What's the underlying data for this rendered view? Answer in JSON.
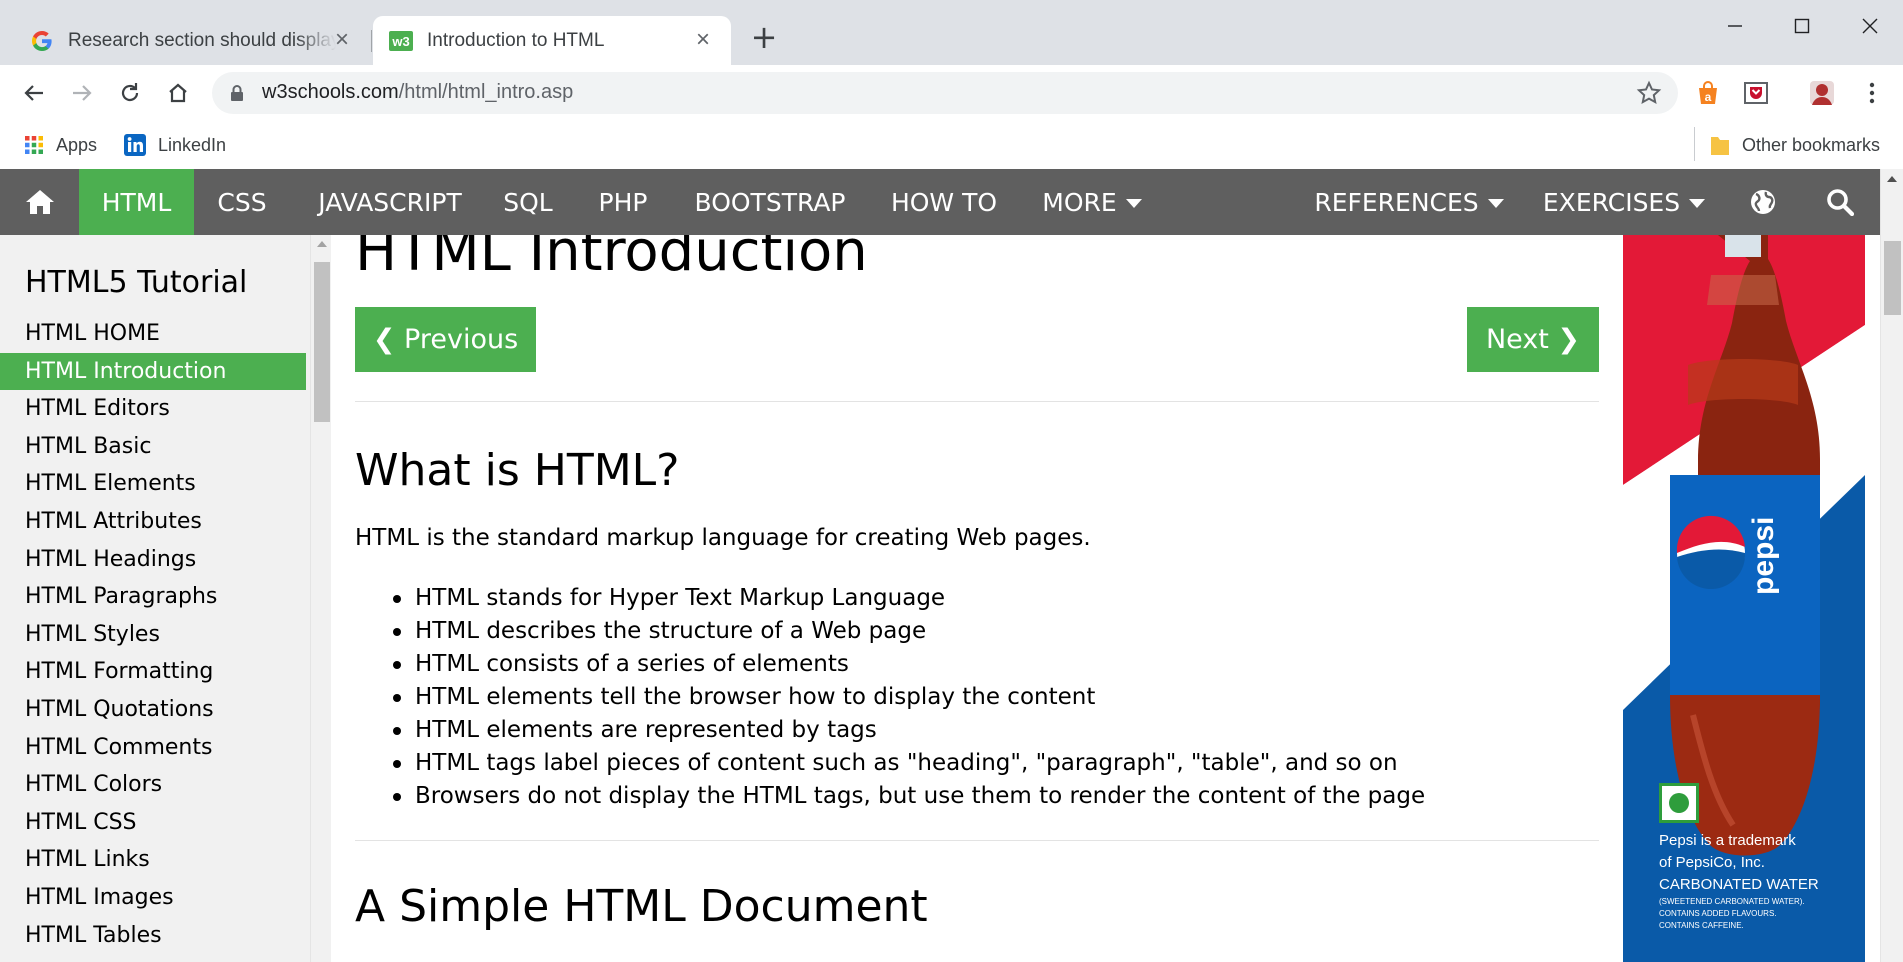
{
  "browser": {
    "tabs": [
      {
        "title": "Research section should display a",
        "favicon": "google-g-icon",
        "active": false
      },
      {
        "title": "Introduction to HTML",
        "favicon": "w3schools-icon",
        "active": true
      }
    ],
    "url_host": "w3schools.com",
    "url_path": "/html/html_intro.asp",
    "bookmarks": [
      {
        "label": "Apps",
        "icon": "apps-grid-icon"
      },
      {
        "label": "LinkedIn",
        "icon": "linkedin-icon"
      }
    ],
    "other_bookmarks": "Other bookmarks"
  },
  "nav": {
    "items": [
      {
        "label": "HTML",
        "active": true
      },
      {
        "label": "CSS"
      },
      {
        "label": "JAVASCRIPT"
      },
      {
        "label": "SQL"
      },
      {
        "label": "PHP"
      },
      {
        "label": "BOOTSTRAP"
      },
      {
        "label": "HOW TO"
      },
      {
        "label": "MORE",
        "dropdown": true
      },
      {
        "label": "REFERENCES",
        "dropdown": true
      },
      {
        "label": "EXERCISES",
        "dropdown": true
      }
    ]
  },
  "sidebar": {
    "heading": "HTML5 Tutorial",
    "items": [
      {
        "label": "HTML HOME"
      },
      {
        "label": "HTML Introduction",
        "active": true
      },
      {
        "label": "HTML Editors"
      },
      {
        "label": "HTML Basic"
      },
      {
        "label": "HTML Elements"
      },
      {
        "label": "HTML Attributes"
      },
      {
        "label": "HTML Headings"
      },
      {
        "label": "HTML Paragraphs"
      },
      {
        "label": "HTML Styles"
      },
      {
        "label": "HTML Formatting"
      },
      {
        "label": "HTML Quotations"
      },
      {
        "label": "HTML Comments"
      },
      {
        "label": "HTML Colors"
      },
      {
        "label": "HTML CSS"
      },
      {
        "label": "HTML Links"
      },
      {
        "label": "HTML Images"
      },
      {
        "label": "HTML Tables"
      }
    ]
  },
  "main": {
    "title": "HTML Introduction",
    "prev_label": "❮ Previous",
    "next_label": "Next ❯",
    "section1_heading": "What is HTML?",
    "section1_intro": "HTML is the standard markup language for creating Web pages.",
    "bullets": [
      "HTML stands for Hyper Text Markup Language",
      "HTML describes the structure of a Web page",
      "HTML consists of a series of elements",
      "HTML elements tell the browser how to display the content",
      "HTML elements are represented by tags",
      "HTML tags label pieces of content such as \"heading\", \"paragraph\", \"table\", and so on",
      "Browsers do not display the HTML tags, but use them to render the content of the page"
    ],
    "section2_heading": "A Simple HTML Document"
  },
  "ad": {
    "brand": "pepsi",
    "line1": "Pepsi is a trademark",
    "line2": "of PepsiCo, Inc.",
    "line3": "CARBONATED WATER",
    "line4": "(SWEETENED CARBONATED WATER).",
    "line5": "CONTAINS ADDED FLAVOURS.",
    "line6": "CONTAINS CAFFEINE."
  },
  "colors": {
    "accent": "#4caf50",
    "navbar": "#5f5f5f",
    "sidebar_bg": "#f1f1f1",
    "pepsi_blue": "#0a5aa8",
    "pepsi_red": "#e31937"
  }
}
